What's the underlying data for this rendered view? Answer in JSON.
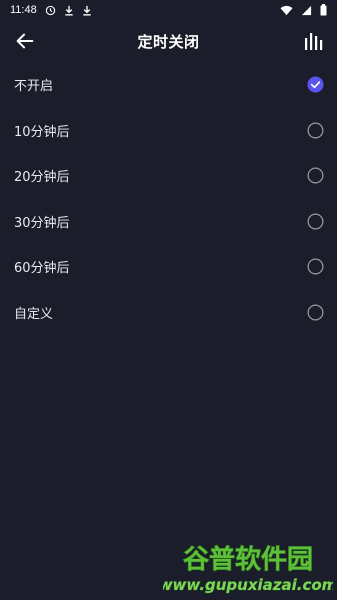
{
  "status_bar": {
    "time": "11:48",
    "icons": [
      "sync-icon",
      "download-icon",
      "download-icon",
      "wifi-icon",
      "signal-icon",
      "battery-icon"
    ]
  },
  "header": {
    "title": "定时关闭",
    "back_icon": "arrow-left-icon",
    "right_icon": "equalizer-icon"
  },
  "options": [
    {
      "label": "不开启",
      "selected": true
    },
    {
      "label": "10分钟后",
      "selected": false
    },
    {
      "label": "20分钟后",
      "selected": false
    },
    {
      "label": "30分钟后",
      "selected": false
    },
    {
      "label": "60分钟后",
      "selected": false
    },
    {
      "label": "自定义",
      "selected": false
    }
  ],
  "watermark": {
    "brand": "谷普软件园",
    "url": "www.gupuxiazai.com"
  },
  "colors": {
    "background": "#1c1d2a",
    "accent": "#5b55f0",
    "radio_border": "#9a9aa5",
    "text": "#e9eaf0"
  }
}
